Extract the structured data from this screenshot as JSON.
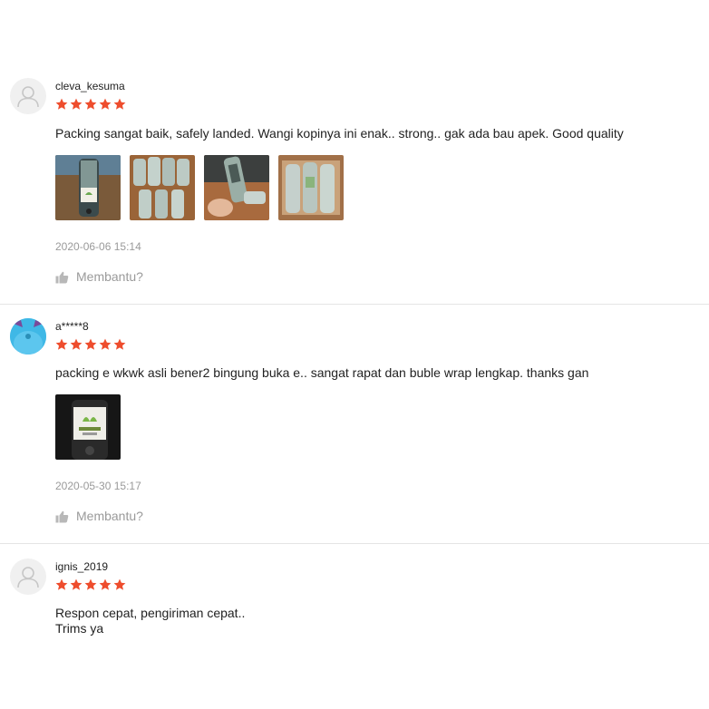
{
  "colors": {
    "star": "#ee4d2d",
    "muted": "#9a9a9a",
    "text": "#222222",
    "divider": "#e5e5e5"
  },
  "reviews": [
    {
      "author": "cleva_kesuma",
      "rating": 5,
      "comment": "Packing sangat baik, safely landed. Wangi kopinya ini enak.. strong.. gak ada bau apek. Good quality",
      "images": [
        "photo-bottle-label",
        "photo-wrapped-bottles",
        "photo-hand-holding-bottle",
        "photo-box-of-bottles"
      ],
      "time": "2020-06-06 15:14",
      "helpful_label": "Membantu?",
      "avatar": "default-user-icon"
    },
    {
      "author": "a*****8",
      "rating": 5,
      "comment": "packing e wkwk asli bener2 bingung buka e.. sangat rapat dan buble wrap lengkap. thanks gan",
      "images": [
        "photo-bottle-label-dark"
      ],
      "time": "2020-05-30 15:17",
      "helpful_label": "Membantu?",
      "avatar": "custom-avatar-blue"
    },
    {
      "author": "ignis_2019",
      "rating": 5,
      "comment": "Respon cepat, pengiriman cepat..\nTrims ya",
      "images": [],
      "time": "",
      "helpful_label": "",
      "avatar": "default-user-icon"
    }
  ]
}
